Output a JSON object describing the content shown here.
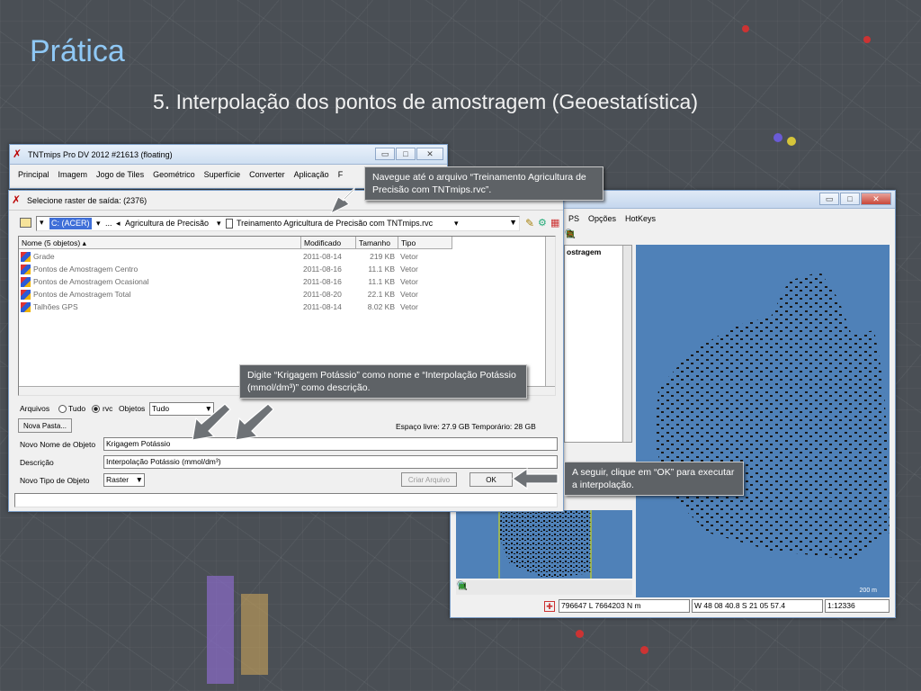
{
  "slide": {
    "title": "Prática",
    "subtitle": "5. Interpolação dos pontos de amostragem (Geoestatística)"
  },
  "main_window": {
    "title": "TNTmips Pro DV 2012  #21613 (floating)",
    "menu": [
      "Principal",
      "Imagem",
      "Jogo de Tiles",
      "Geométrico",
      "Superfície",
      "Converter",
      "Aplicação",
      "F"
    ]
  },
  "view_window": {
    "menu": [
      "PS",
      "Opções",
      "HotKeys"
    ],
    "legend_label": "ostragem",
    "scale_text": "200 m",
    "status": {
      "coords": "796647 L  7664203 N m",
      "latlon": "W 48 08 40.8  S 21 05 57.4",
      "scale": "1:12336"
    }
  },
  "dialog": {
    "title": "Selecione raster de saída: (2376)",
    "path": {
      "drive": "C: (ACER)",
      "ellipsis": "...",
      "folder": "Agricultura de Precisão",
      "file": "Treinamento Agricultura de Precisão com TNTmips.rvc"
    },
    "columns": [
      "Nome  (5 objetos)",
      "Modificado",
      "Tamanho",
      "Tipo"
    ],
    "files": [
      {
        "name": "Grade",
        "modified": "2011-08-14",
        "size": "219 KB",
        "type": "Vetor"
      },
      {
        "name": "Pontos de Amostragem Centro",
        "modified": "2011-08-16",
        "size": "11.1 KB",
        "type": "Vetor"
      },
      {
        "name": "Pontos de Amostragem Ocasional",
        "modified": "2011-08-16",
        "size": "11.1 KB",
        "type": "Vetor"
      },
      {
        "name": "Pontos de Amostragem Total",
        "modified": "2011-08-20",
        "size": "22.1 KB",
        "type": "Vetor"
      },
      {
        "name": "Talhões GPS",
        "modified": "2011-08-14",
        "size": "8.02 KB",
        "type": "Vetor"
      }
    ],
    "filter": {
      "arquivos_label": "Arquivos",
      "tudo_label": "Tudo",
      "rvc_label": "rvc",
      "objetos_label": "Objetos",
      "objetos_value": "Tudo"
    },
    "nova_pasta": "Nova Pasta...",
    "space": "Espaço livre: 27.9 GB   Temporário: 28 GB",
    "object_name_label": "Novo Nome de Objeto",
    "object_name_value": "Krigagem Potássio",
    "description_label": "Descrição",
    "description_value": "Interpolação Potássio (mmol/dm³)",
    "object_type_label": "Novo Tipo de Objeto",
    "object_type_value": "Raster",
    "criar_arquivo": "Criar Arquivo",
    "ok": "OK"
  },
  "callouts": {
    "navigate": "Navegue até o arquivo “Treinamento Agricultura de Precisão com TNTmips.rvc”.",
    "type_name": "Digite “Krigagem Potássio” como nome e “Interpolação Potássio (mmol/dm³)” como descrição.",
    "click_ok": "A seguir, clique em “OK” para executar a interpolação."
  },
  "colors": {
    "title_color": "#8fc8f5",
    "map_water": "#4f81b8",
    "callout_bg": "#5e6266"
  }
}
